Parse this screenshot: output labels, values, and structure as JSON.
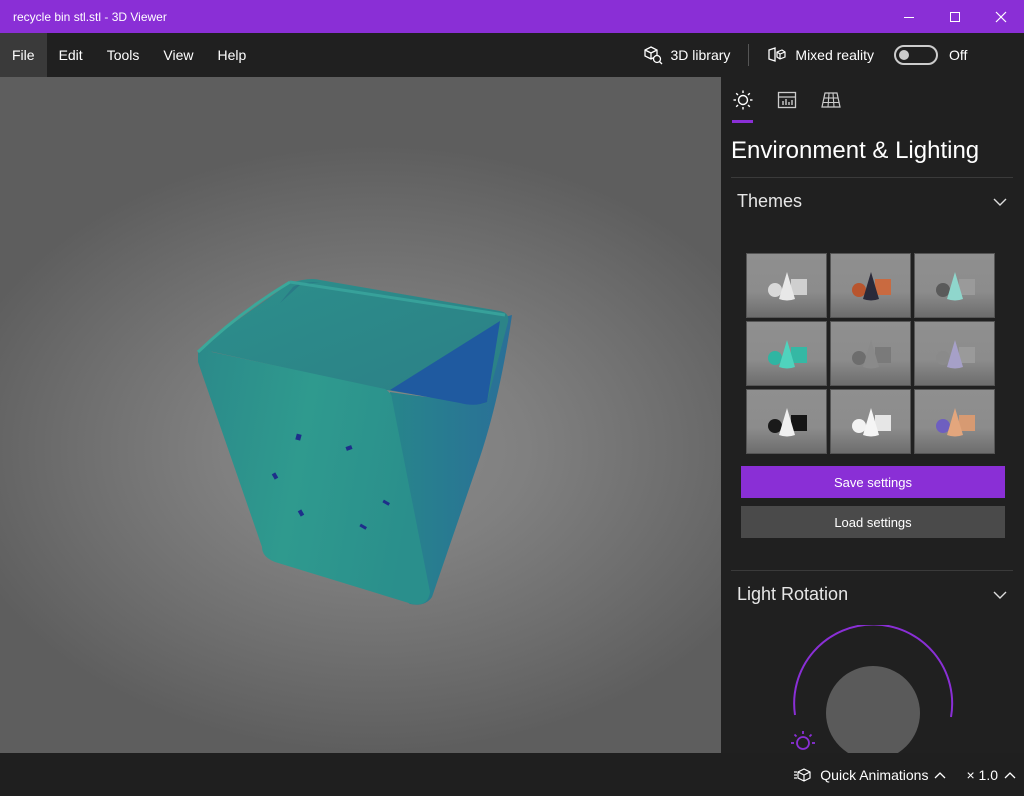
{
  "window": {
    "title": "recycle bin stl.stl - 3D Viewer"
  },
  "menu": {
    "items": [
      "File",
      "Edit",
      "Tools",
      "View",
      "Help"
    ]
  },
  "toolbar": {
    "library_label": "3D library",
    "mixed_reality_label": "Mixed reality",
    "mixed_reality_state": "Off"
  },
  "panel": {
    "title": "Environment & Lighting",
    "themes_label": "Themes",
    "save_label": "Save settings",
    "load_label": "Load settings",
    "light_rotation_label": "Light Rotation"
  },
  "themes": [
    {
      "name": "light-neutral",
      "sphere": "#d9d9d9",
      "cone": "#e8e8e8",
      "box": "#cfcfcf"
    },
    {
      "name": "warm-contrast",
      "sphere": "#b8552e",
      "cone": "#2a2a3a",
      "box": "#c96a40"
    },
    {
      "name": "teal-grey",
      "sphere": "#5a5a5a",
      "cone": "#8fd6cc",
      "box": "#9a9a9a"
    },
    {
      "name": "teal-green",
      "sphere": "#2fb5a2",
      "cone": "#4fd3bd",
      "box": "#35b8a4"
    },
    {
      "name": "dark-grey",
      "sphere": "#6d6d6d",
      "cone": "#8a8a8a",
      "box": "#7a7a7a"
    },
    {
      "name": "lavender",
      "sphere": "#8a8a8a",
      "cone": "#a6a0c8",
      "box": "#9a9a9a"
    },
    {
      "name": "black-white",
      "sphere": "#1a1a1a",
      "cone": "#f0f0f0",
      "box": "#151515"
    },
    {
      "name": "white",
      "sphere": "#f2f2f2",
      "cone": "#f5f5f5",
      "box": "#e6e6e6"
    },
    {
      "name": "peach-violet",
      "sphere": "#6e5fc0",
      "cone": "#e3a67d",
      "box": "#d79a72"
    }
  ],
  "status": {
    "quick_animations_label": "Quick Animations",
    "speed": "× 1.0"
  },
  "colors": {
    "accent": "#8a2fd6",
    "model": "#2f8f86"
  }
}
